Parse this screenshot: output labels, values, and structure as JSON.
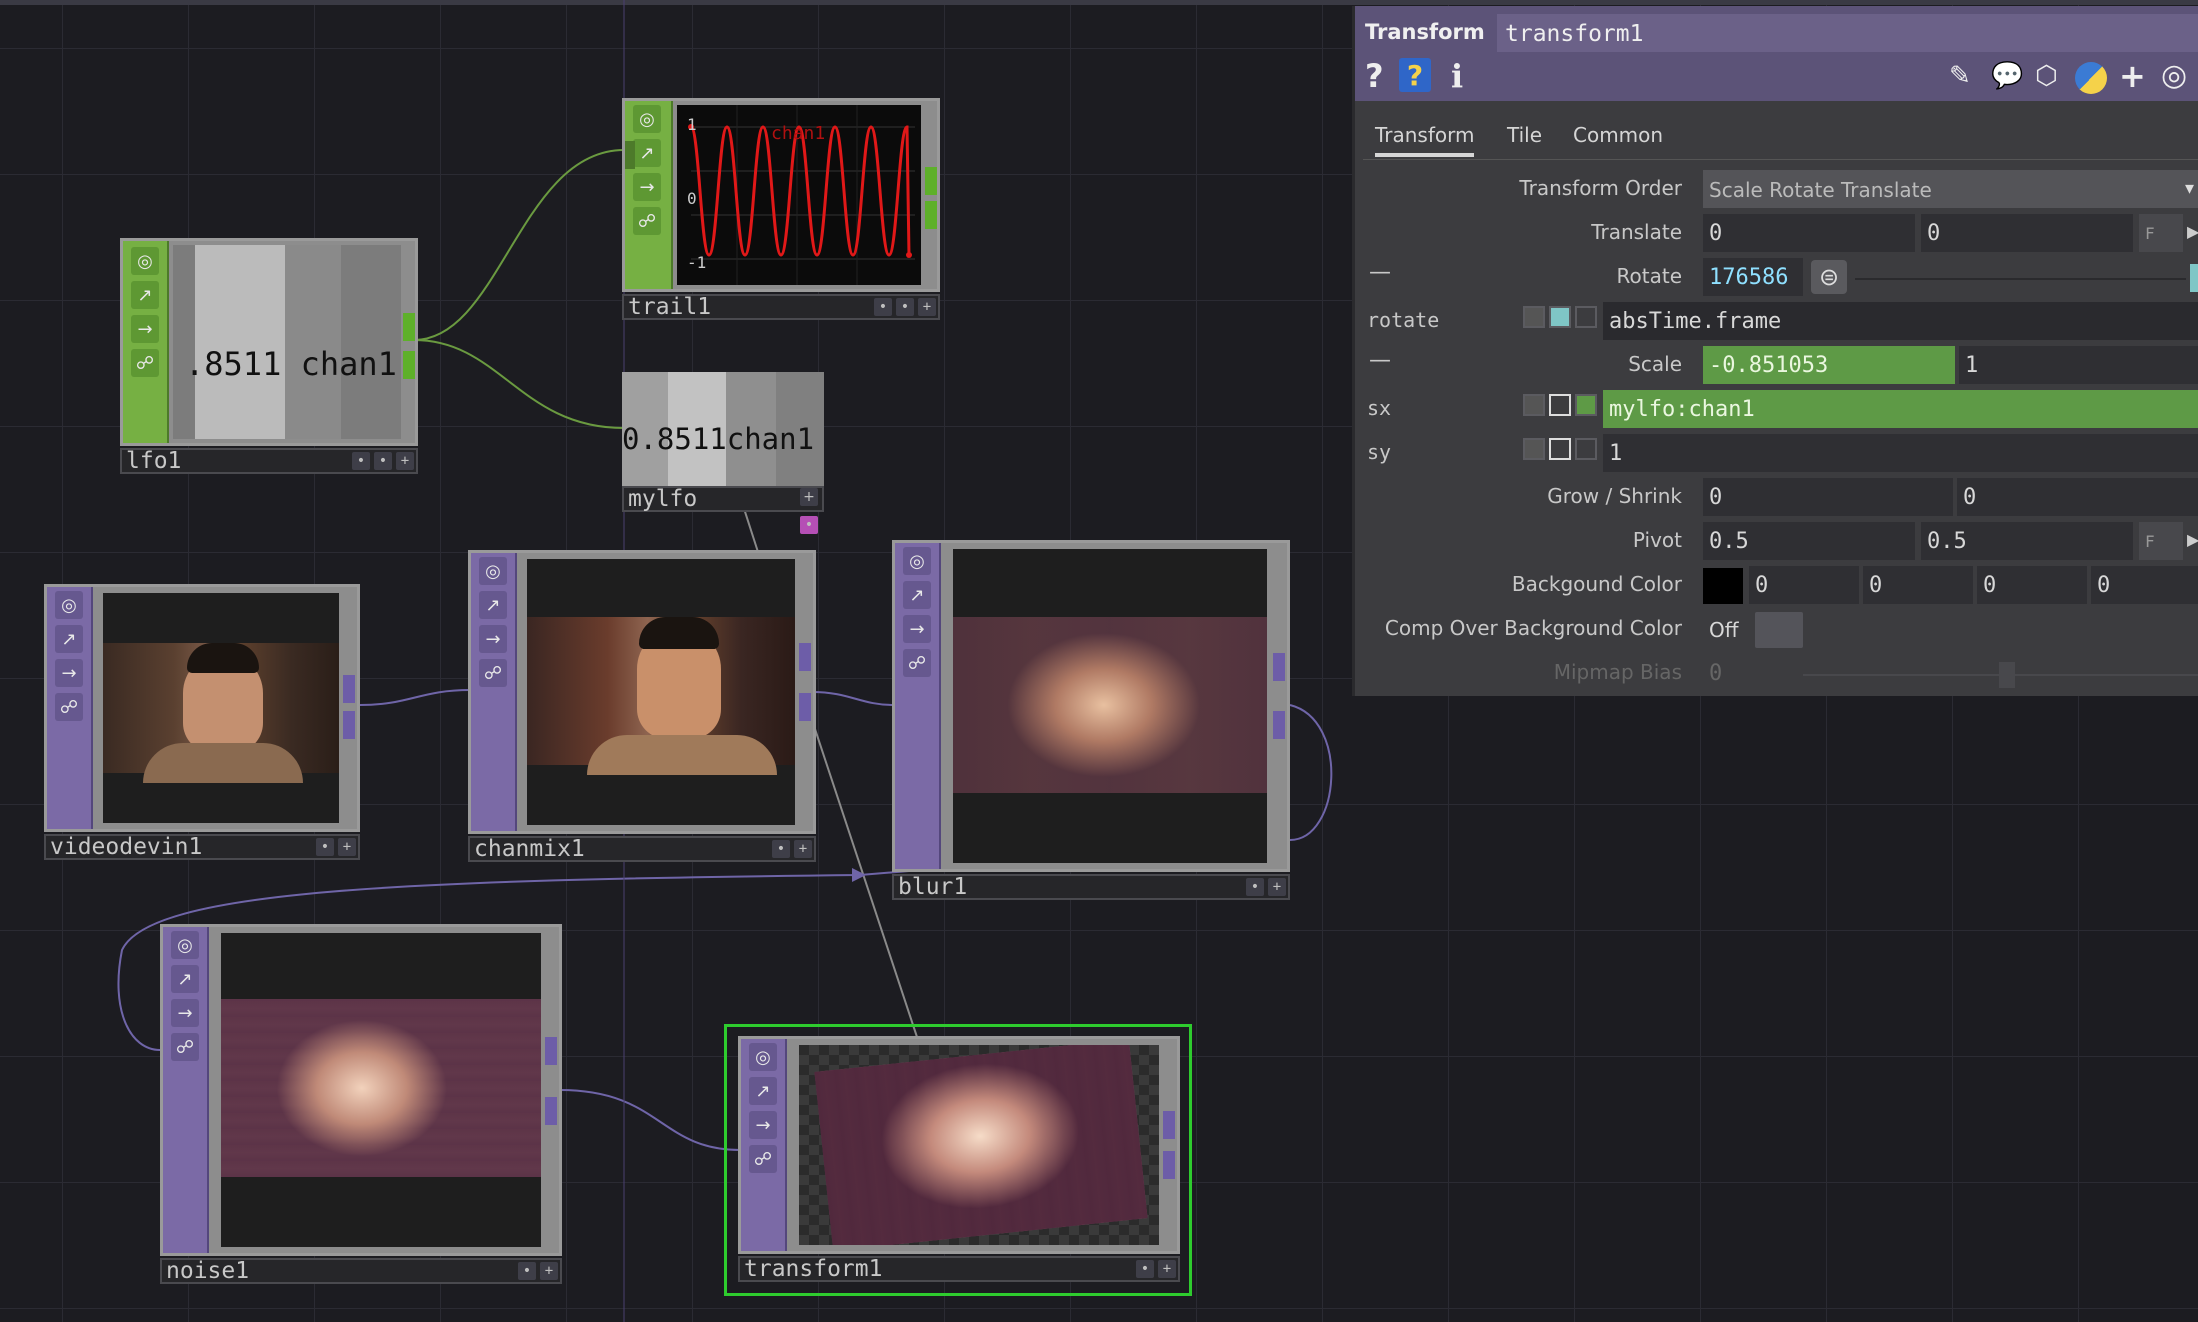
{
  "network": {
    "nodes": {
      "lfo1": {
        "label": "lfo1",
        "readout": ".8511 chan1"
      },
      "trail1": {
        "label": "trail1",
        "ytick_top": "1",
        "ytick_mid": "0",
        "ytick_bot": "-1",
        "channel": "chan1"
      },
      "mylfo": {
        "label": "mylfo",
        "readout": "0.8511chan1"
      },
      "videodevin1": {
        "label": "videodevin1"
      },
      "chanmix1": {
        "label": "chanmix1"
      },
      "blur1": {
        "label": "blur1"
      },
      "noise1": {
        "label": "noise1"
      },
      "transform1": {
        "label": "transform1"
      }
    }
  },
  "panel": {
    "op_type": "Transform",
    "op_name": "transform1",
    "header_icons": [
      "help-icon",
      "op-help-icon",
      "info-icon",
      "pencil-icon",
      "comment-icon",
      "clone-icon",
      "python-icon",
      "add-icon",
      "viewer-icon"
    ],
    "tabs": [
      "Transform",
      "Tile",
      "Common"
    ],
    "params": {
      "transform_order": {
        "label": "Transform Order",
        "value": "Scale Rotate Translate"
      },
      "translate": {
        "label": "Translate",
        "x": "0",
        "y": "0",
        "unit_btn": "F"
      },
      "rotate": {
        "label": "Rotate",
        "value": "176586",
        "expr_name": "rotate",
        "expr": "absTime.frame",
        "collapse": "—"
      },
      "scale": {
        "label": "Scale",
        "x": "-0.851053",
        "y": "1",
        "collapse": "—",
        "sx_name": "sx",
        "sx_expr": "mylfo:chan1",
        "sy_name": "sy",
        "sy_value": "1"
      },
      "grow_shrink": {
        "label": "Grow / Shrink",
        "x": "0",
        "y": "0"
      },
      "pivot": {
        "label": "Pivot",
        "x": "0.5",
        "y": "0.5",
        "unit_btn": "F"
      },
      "bg_color": {
        "label": "Backgound Color",
        "r": "0",
        "g": "0",
        "b": "0",
        "a": "0",
        "swatch": "#000000"
      },
      "comp_over": {
        "label": "Comp Over Background Color",
        "value": "Off"
      },
      "mipmap": {
        "label": "Mipmap Bias",
        "value": "0"
      }
    }
  },
  "colors": {
    "chop": "#76b043",
    "top": "#7b6aa6",
    "panel_header": "#5c5378",
    "selected_outline": "#2ecc2e",
    "param_expr_green": "#5e9a46"
  }
}
